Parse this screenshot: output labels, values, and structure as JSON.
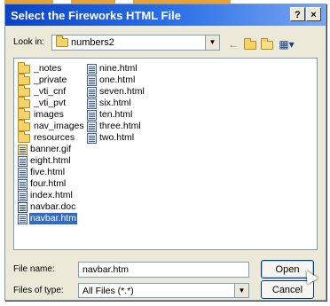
{
  "dialog": {
    "title": "Select the Fireworks HTML File",
    "help_button": "?",
    "close_button": "×"
  },
  "look_in": {
    "label": "Look in:",
    "value": "numbers2"
  },
  "toolbar_icons": [
    "back-icon",
    "up-folder-icon",
    "new-folder-icon",
    "view-menu-icon"
  ],
  "files": {
    "column1": [
      {
        "name": "_notes",
        "type": "folder"
      },
      {
        "name": "_private",
        "type": "folder"
      },
      {
        "name": "_vti_cnf",
        "type": "folder"
      },
      {
        "name": "_vti_pvt",
        "type": "folder"
      },
      {
        "name": "images",
        "type": "folder"
      },
      {
        "name": "nav_images",
        "type": "folder"
      },
      {
        "name": "resources",
        "type": "folder"
      },
      {
        "name": "banner.gif",
        "type": "gif"
      },
      {
        "name": "eight.html",
        "type": "html"
      },
      {
        "name": "five.html",
        "type": "html"
      },
      {
        "name": "four.html",
        "type": "html"
      },
      {
        "name": "index.html",
        "type": "html"
      },
      {
        "name": "navbar.doc",
        "type": "doc"
      },
      {
        "name": "navbar.htm",
        "type": "html",
        "selected": true
      }
    ],
    "column2": [
      {
        "name": "nine.html",
        "type": "html"
      },
      {
        "name": "one.html",
        "type": "html"
      },
      {
        "name": "seven.html",
        "type": "html"
      },
      {
        "name": "six.html",
        "type": "html"
      },
      {
        "name": "ten.html",
        "type": "html"
      },
      {
        "name": "three.html",
        "type": "html"
      },
      {
        "name": "two.html",
        "type": "html"
      }
    ]
  },
  "file_name": {
    "label": "File name:",
    "value": "navbar.htm"
  },
  "file_type": {
    "label": "Files of type:",
    "value": "All Files (*.*)"
  },
  "buttons": {
    "open": "Open",
    "cancel": "Cancel"
  },
  "colors": {
    "title_bar": "#0a43c8",
    "selection": "#316ac5",
    "dialog_bg": "#ece9d8",
    "top_strip": "#e7a23a"
  }
}
